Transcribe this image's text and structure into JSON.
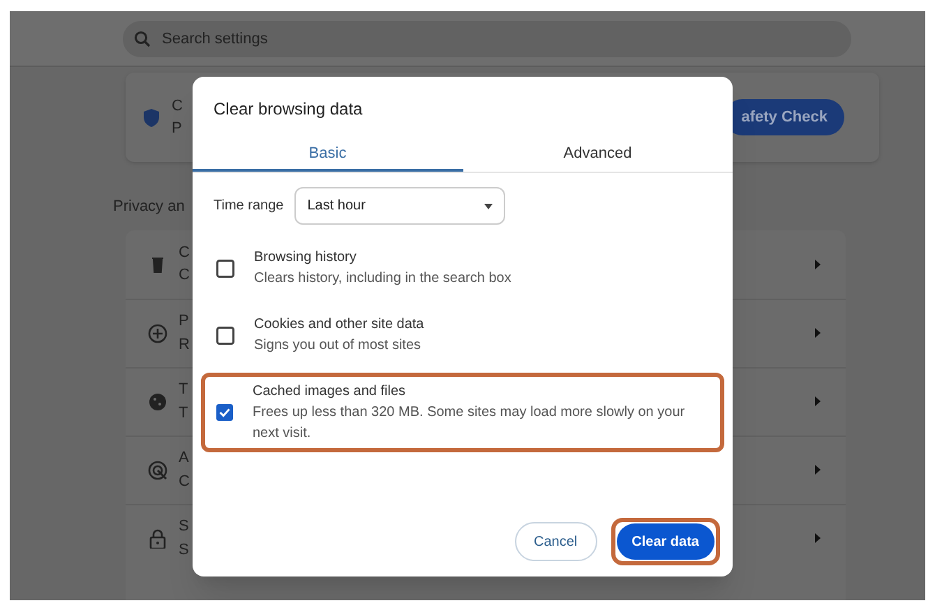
{
  "background": {
    "search": {
      "placeholder": "Search settings"
    },
    "safety_card": {
      "title": "C",
      "subtitle": "P",
      "button": "afety Check"
    },
    "section_heading": "Privacy an",
    "rows": [
      {
        "title": "C",
        "subtitle": "C"
      },
      {
        "title": "P",
        "subtitle": "R"
      },
      {
        "title": "T",
        "subtitle": "T"
      },
      {
        "title": "A",
        "subtitle": "C"
      },
      {
        "title": "S",
        "subtitle": "S"
      }
    ]
  },
  "dialog": {
    "title": "Clear browsing data",
    "tabs": [
      {
        "label": "Basic",
        "selected": true
      },
      {
        "label": "Advanced",
        "selected": false
      }
    ],
    "time_range": {
      "label": "Time range",
      "value": "Last hour"
    },
    "options": [
      {
        "title": "Browsing history",
        "description": "Clears history, including in the search box",
        "checked": false,
        "highlighted": false
      },
      {
        "title": "Cookies and other site data",
        "description": "Signs you out of most sites",
        "checked": false,
        "highlighted": false
      },
      {
        "title": "Cached images and files",
        "description": "Frees up less than 320 MB. Some sites may load more slowly on your next visit.",
        "checked": true,
        "highlighted": true
      }
    ],
    "buttons": [
      {
        "label": "Cancel",
        "kind": "secondary",
        "highlighted": false
      },
      {
        "label": "Clear data",
        "kind": "primary",
        "highlighted": true
      }
    ]
  }
}
